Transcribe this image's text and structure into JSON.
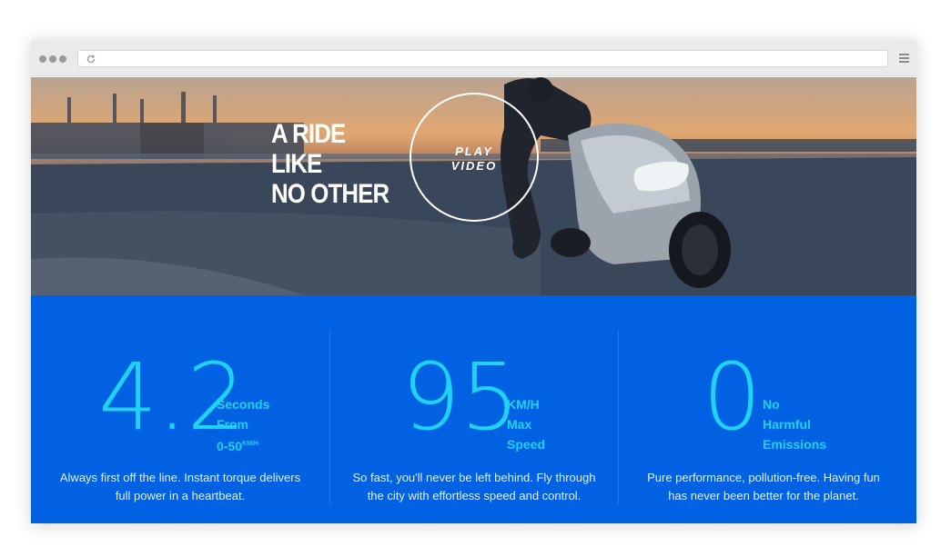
{
  "browser": {
    "url": ""
  },
  "hero": {
    "headline": [
      "A RIDE",
      "LIKE",
      "NO OTHER"
    ],
    "play_video": [
      "PLAY",
      "VIDEO"
    ]
  },
  "stats": [
    {
      "value": "4.2",
      "label": [
        "Seconds",
        "From",
        "0-50"
      ],
      "label_superscript": "KM/H",
      "description": [
        "Always first off the line. Instant torque delivers",
        "full power in a heartbeat."
      ]
    },
    {
      "value": "95",
      "label": [
        "KM/H",
        "Max",
        "Speed"
      ],
      "description": [
        "So fast, you'll never be left behind. Fly through",
        "the city with effortless speed and control."
      ]
    },
    {
      "value": "0",
      "label": [
        "No",
        "Harmful",
        "Emissions"
      ],
      "description": [
        "Pure performance, pollution-free. Having fun",
        "has never been better for the planet."
      ]
    }
  ],
  "colors": {
    "stats_background": "#0062e3",
    "stat_accent": "#1fd2f7",
    "browser_chrome": "#eaeaea"
  }
}
